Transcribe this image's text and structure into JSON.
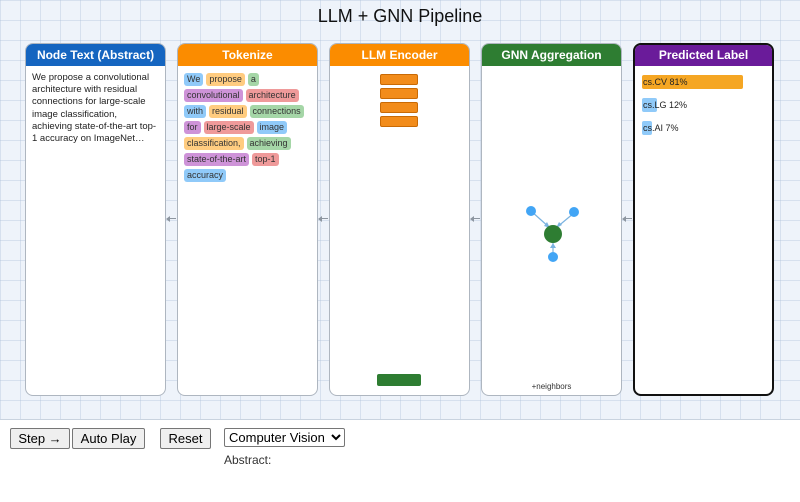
{
  "title": "LLM + GNN Pipeline",
  "panels": [
    {
      "title": "Node Text (Abstract)",
      "color": "#1565c0"
    },
    {
      "title": "Tokenize",
      "color": "#fb8c00"
    },
    {
      "title": "LLM Encoder",
      "color": "#fb8c00"
    },
    {
      "title": "GNN Aggregation",
      "color": "#2e7d32"
    },
    {
      "title": "Predicted Label",
      "color": "#6a1b9a"
    }
  ],
  "abstract_text": "We propose a convolutional architecture with residual connections for large-scale image classification, achieving state-of-the-art top-1 accuracy on ImageNet…",
  "tokens": [
    {
      "text": "We",
      "color": "#90caf9"
    },
    {
      "text": "propose",
      "color": "#ffcc80"
    },
    {
      "text": "a",
      "color": "#a5d6a7"
    },
    {
      "text": "convolutional",
      "color": "#ce93d8"
    },
    {
      "text": "architecture",
      "color": "#ef9a9a"
    },
    {
      "text": "with",
      "color": "#90caf9"
    },
    {
      "text": "residual",
      "color": "#ffcc80"
    },
    {
      "text": "connections",
      "color": "#a5d6a7"
    },
    {
      "text": "for",
      "color": "#ce93d8"
    },
    {
      "text": "large-scale",
      "color": "#ef9a9a"
    },
    {
      "text": "image",
      "color": "#90caf9"
    },
    {
      "text": "classification,",
      "color": "#ffcc80"
    },
    {
      "text": "achieving",
      "color": "#a5d6a7"
    },
    {
      "text": "state-of-the-art",
      "color": "#ce93d8"
    },
    {
      "text": "top-1",
      "color": "#ef9a9a"
    },
    {
      "text": "accuracy",
      "color": "#90caf9"
    }
  ],
  "encoder": {
    "layer_color": "#f28c1b",
    "embedding_color": "#2e7d32"
  },
  "gnn": {
    "note": "+neighbors",
    "center_color": "#2e7d32",
    "neighbor_color": "#42a5f5"
  },
  "predictions": [
    {
      "label": "cs.CV 81%",
      "value": 0.81,
      "color": "#f5a623"
    },
    {
      "label": "cs.LG 12%",
      "value": 0.12,
      "color": "#90caf9"
    },
    {
      "label": "cs.AI 7%",
      "value": 0.07,
      "color": "#90caf9"
    }
  ],
  "controls": {
    "step_label": "Step →",
    "autoplay_label": "Auto Play",
    "reset_label": "Reset",
    "dataset_selected": "Computer Vision",
    "abstract_label": "Abstract:"
  }
}
